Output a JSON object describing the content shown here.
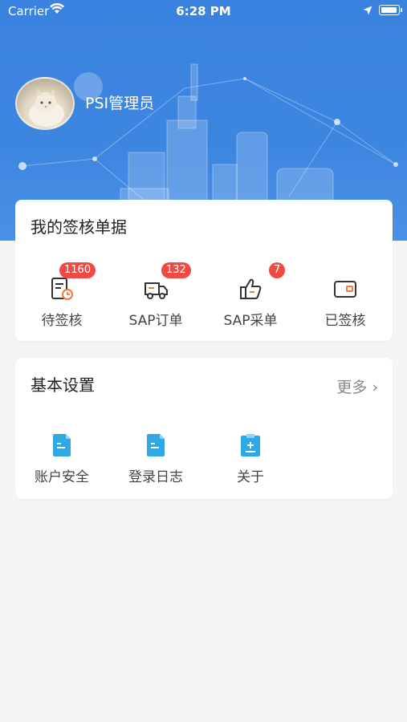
{
  "status_bar": {
    "carrier": "Carrier",
    "time": "6:28 PM"
  },
  "profile": {
    "username": "PSI管理员"
  },
  "my_documents": {
    "title": "我的签核单据",
    "items": [
      {
        "label": "待签核",
        "badge": "1160",
        "icon": "pending-doc-icon"
      },
      {
        "label": "SAP订单",
        "badge": "132",
        "icon": "truck-icon"
      },
      {
        "label": "SAP采单",
        "badge": "7",
        "icon": "thumbs-up-icon"
      },
      {
        "label": "已签核",
        "badge": "",
        "icon": "wallet-icon"
      }
    ]
  },
  "basic_settings": {
    "title": "基本设置",
    "more_label": "更多",
    "items": [
      {
        "label": "账户安全",
        "icon": "document-icon"
      },
      {
        "label": "登录日志",
        "icon": "document-icon"
      },
      {
        "label": "关于",
        "icon": "clipboard-plus-icon"
      }
    ]
  },
  "colors": {
    "header": "#3a82df",
    "badge": "#f04a45",
    "accent_orange": "#f07a3a"
  }
}
